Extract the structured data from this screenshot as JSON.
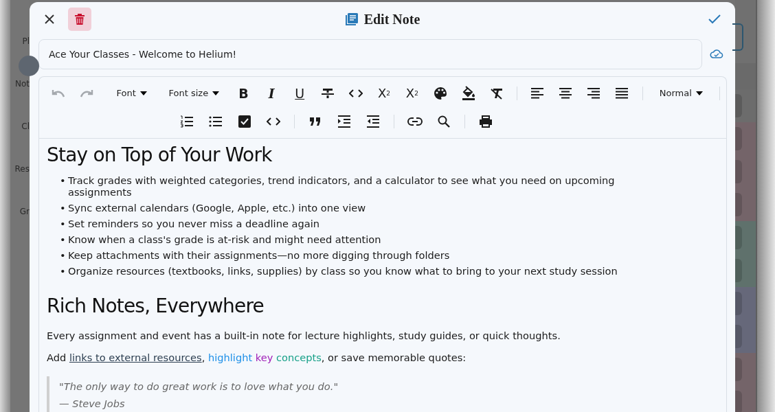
{
  "background": {
    "sidebar_labels": [
      "Pl",
      "Not",
      "Cl",
      "Res",
      "Gr"
    ],
    "rows": [
      {
        "color": "#6c6c6c"
      },
      {
        "color": "#746469"
      },
      {
        "color": "#746469"
      },
      {
        "color": "#746469"
      },
      {
        "color": "#5f716c"
      },
      {
        "color": "#5f716c"
      },
      {
        "color": "#66687a"
      },
      {
        "color": "#66687a"
      },
      {
        "color": "#746469"
      },
      {
        "color": "#746469"
      }
    ]
  },
  "dialog": {
    "title": "Edit Note",
    "note_title": "Ace Your Classes - Welcome to Helium!"
  },
  "toolbar": {
    "undo_disabled": true,
    "redo_disabled": true,
    "font": "Font",
    "font_size": "Font size",
    "bold": "B",
    "italic": "I",
    "underline": "U",
    "subscript": "X",
    "subscript_mark": "2",
    "superscript": "X",
    "superscript_mark": "2",
    "block_style": "Normal"
  },
  "content": [
    {
      "kind": "h1",
      "text": "Stay on Top of Your Work"
    },
    {
      "kind": "list",
      "marker": "•",
      "items": [
        "Track grades with weighted categories, trend indicators, and a calculator to see what you need on upcoming assignments",
        "Sync external calendars (Google, Apple, etc.) into one view",
        "Set reminders so you never miss a deadline again",
        "Know when a class's grade is at-risk and might need attention",
        "Keep attachments with their assignments—no more digging through folders",
        "Organize resources (textbooks, links, supplies) by class so you know what to bring to your next study session"
      ]
    },
    {
      "kind": "h2",
      "text": "Rich Notes, Everywhere"
    },
    {
      "kind": "p",
      "segments": [
        {
          "kind": "plain",
          "text": "Every assignment and event has a built-in note for lecture highlights, study guides, or quick thoughts."
        }
      ]
    },
    {
      "kind": "p",
      "segments": [
        {
          "kind": "plain",
          "text": "Add "
        },
        {
          "kind": "link",
          "text": "links to external resources"
        },
        {
          "kind": "plain",
          "text": ", "
        },
        {
          "kind": "colored",
          "text": "highlight",
          "color": "#1e90e8"
        },
        {
          "kind": "colored",
          "text": " key",
          "color": "#a020b8"
        },
        {
          "kind": "colored",
          "text": " concepts",
          "color": "#16a088"
        },
        {
          "kind": "plain",
          "text": ", or save memorable quotes:"
        }
      ]
    },
    {
      "kind": "quote",
      "lines": [
        "\"The only way to do great work is to love what you do.\"",
        "— Steve Jobs"
      ]
    }
  ]
}
